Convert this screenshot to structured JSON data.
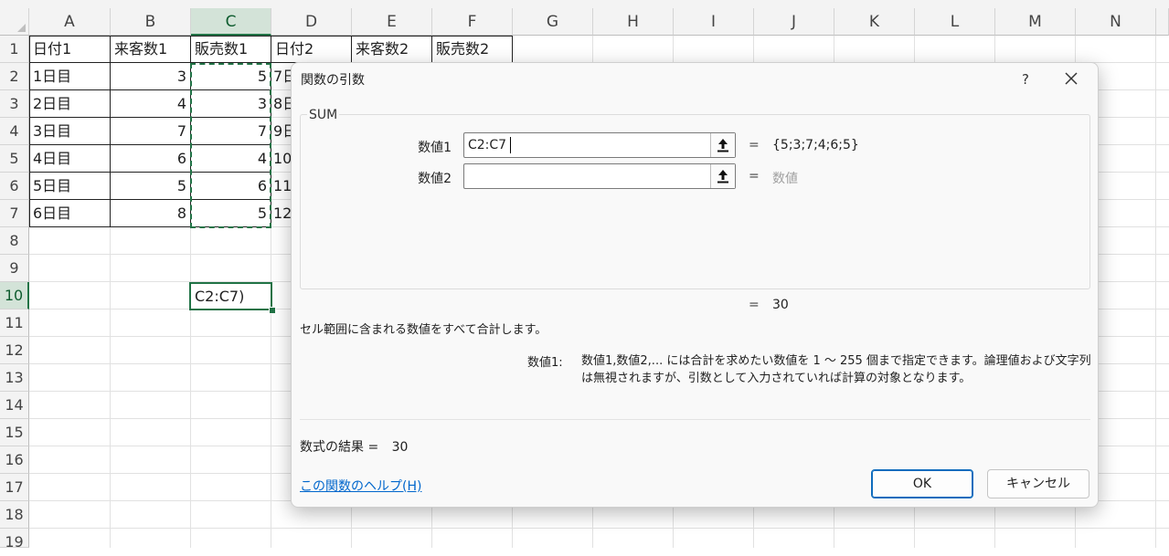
{
  "sheet": {
    "columns": [
      "A",
      "B",
      "C",
      "D",
      "E",
      "F",
      "G",
      "H",
      "I",
      "J",
      "K",
      "L",
      "M",
      "N"
    ],
    "rows": [
      "1",
      "2",
      "3",
      "4",
      "5",
      "6",
      "7",
      "8",
      "9",
      "10",
      "11",
      "12",
      "13",
      "14",
      "15",
      "16",
      "17",
      "18",
      "19"
    ],
    "selected_column": "C",
    "selected_row": "10",
    "headers": {
      "a1": "日付1",
      "b1": "来客数1",
      "c1": "販売数1",
      "d1": "日付2",
      "e1": "来客数2",
      "f1": "販売数2"
    },
    "col_a": [
      "1日目",
      "2日目",
      "3日目",
      "4日目",
      "5日目",
      "6日目"
    ],
    "col_b": [
      "3",
      "4",
      "7",
      "6",
      "5",
      "8"
    ],
    "col_c": [
      "5",
      "3",
      "7",
      "4",
      "6",
      "5"
    ],
    "col_d_partial": [
      "7日",
      "8日",
      "9日",
      "10",
      "11",
      "12"
    ],
    "active_cell_text": "C2:C7)"
  },
  "dialog": {
    "title": "関数の引数",
    "help_button": "?",
    "close_button": "✕",
    "function_name": "SUM",
    "arguments": [
      {
        "label": "数値1",
        "value": "C2:C7",
        "result": "{5;3;7;4;6;5}"
      },
      {
        "label": "数値2",
        "value": "",
        "placeholder": "数値"
      }
    ],
    "equals": "=",
    "arguments_total": "30",
    "description": "セル範囲に含まれる数値をすべて合計します。",
    "arg_description_label": "数値1:",
    "arg_description_text": "数値1,数値2,... には合計を求めたい数値を 1 ～ 255 個まで指定できます。論理値および文字列は無視されますが、引数として入力されていれば計算の対象となります。",
    "formula_result_label": "数式の結果 =",
    "formula_result_value": "30",
    "help_link": "この関数のヘルプ(H)",
    "ok_button": "OK",
    "cancel_button": "キャンセル"
  },
  "colors": {
    "accent_green": "#217346",
    "link_blue": "#0066cc",
    "primary_button_border": "#0f6cbd"
  }
}
